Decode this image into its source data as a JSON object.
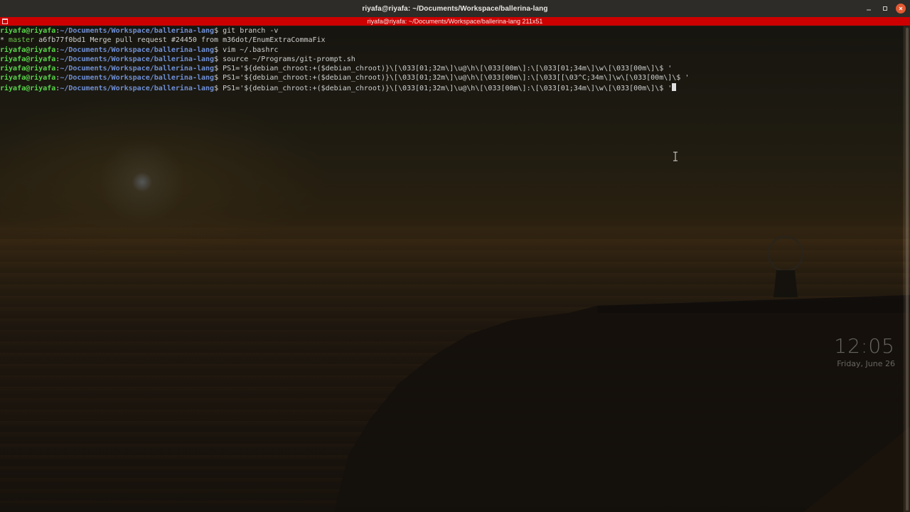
{
  "window": {
    "title": "riyafa@riyafa: ~/Documents/Workspace/ballerina-lang",
    "buttons": {
      "minimize_icon": "minimize-icon",
      "maximize_icon": "maximize-icon",
      "close_icon": "close-icon",
      "close_color": "#e25a33"
    }
  },
  "tab": {
    "title": "riyafa@riyafa: ~/Documents/Workspace/ballerina-lang 211x51",
    "bar_color": "#cc0000"
  },
  "terminal": {
    "lines": [
      {
        "user": "riyafa@riyafa",
        "sep": ":",
        "path": "~/Documents/Workspace/ballerina-lang",
        "prompt": "$",
        "cmd": " git branch -v"
      },
      {
        "plain_prefix": "* ",
        "branch": "master",
        "rest": " a6fb77f0bd1 Merge pull request #24450 from m36dot/EnumExtraCommaFix"
      },
      {
        "user": "riyafa@riyafa",
        "sep": ":",
        "path": "~/Documents/Workspace/ballerina-lang",
        "prompt": "$",
        "cmd": " vim ~/.bashrc"
      },
      {
        "user": "riyafa@riyafa",
        "sep": ":",
        "path": "~/Documents/Workspace/ballerina-lang",
        "prompt": "$",
        "cmd": " source ~/Programs/git-prompt.sh"
      },
      {
        "user": "riyafa@riyafa",
        "sep": ":",
        "path": "~/Documents/Workspace/ballerina-lang",
        "prompt": "$",
        "cmd": " PS1='${debian_chroot:+($debian_chroot)}\\[\\033[01;32m\\]\\u@\\h\\[\\033[00m\\]:\\[\\033[01;34m\\]\\w\\[\\033[00m\\]\\$ '"
      },
      {
        "user": "riyafa@riyafa",
        "sep": ":",
        "path": "~/Documents/Workspace/ballerina-lang",
        "prompt": "$",
        "cmd": " PS1='${debian_chroot:+($debian_chroot)}\\[\\033[01;32m\\]\\u@\\h\\[\\033[00m\\]:\\[\\033[[\\03^C;34m\\]\\w\\[\\033[00m\\]\\$ '"
      },
      {
        "user": "riyafa@riyafa",
        "sep": ":",
        "path": "~/Documents/Workspace/ballerina-lang",
        "prompt": "$",
        "cmd": " PS1='${debian_chroot:+($debian_chroot)}\\[\\033[01;32m\\]\\u@\\h\\[\\033[00m\\]:\\[\\033[01;34m\\]\\w\\[\\033[00m\\]\\$ '"
      }
    ],
    "colors": {
      "user": "#58d34a",
      "path": "#6f8fd4",
      "branch": "#6ac44b",
      "text": "#cfd0cf"
    }
  },
  "clock": {
    "time": "12:05",
    "date": "Friday, June 26"
  },
  "icons": {
    "terminal_tab_icon": "terminal-icon",
    "mouse": "text-cursor-icon"
  }
}
